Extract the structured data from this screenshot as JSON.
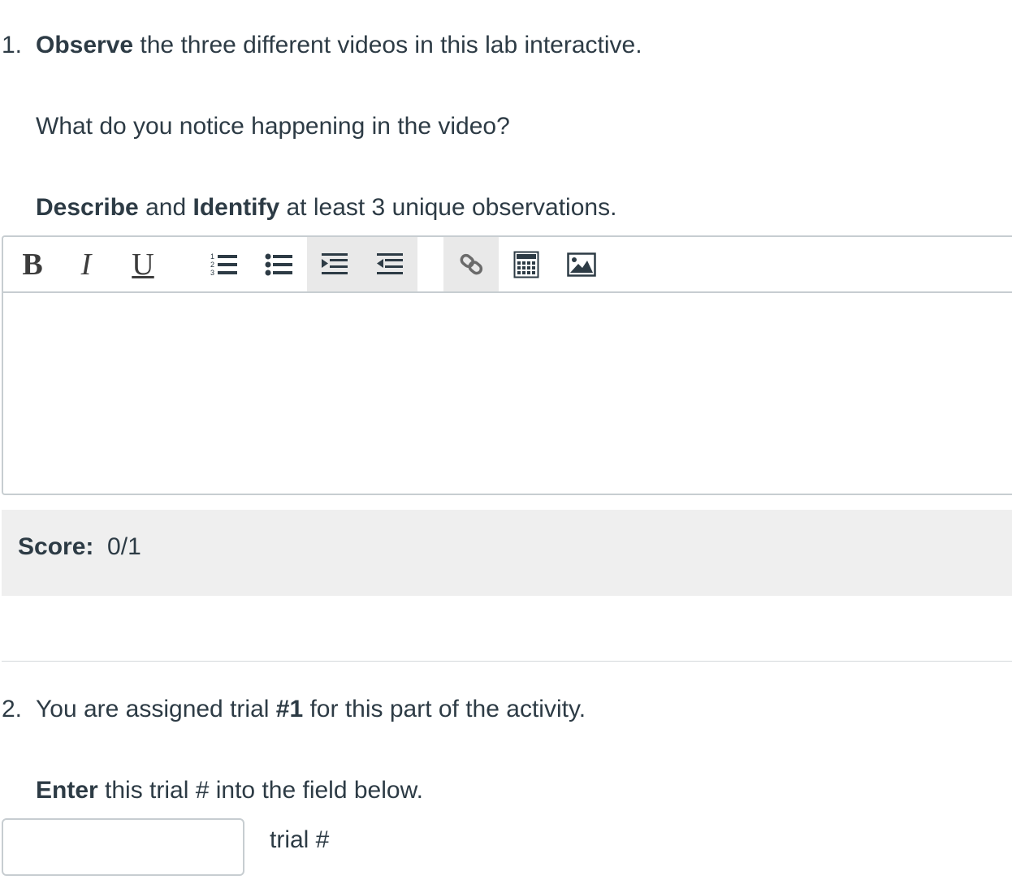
{
  "question1": {
    "number": "1.",
    "bold_lead": "Observe",
    "rest": " the three different videos in this lab interactive.",
    "prompt": "What do you notice happening in the video?",
    "instruction": {
      "bold_a": "Describe",
      "mid_a": " and ",
      "bold_b": "Identify",
      "rest": " at least 3 unique observations."
    }
  },
  "editor": {
    "toolbar": {
      "bold_label": "B",
      "italic_label": "I",
      "underline_label": "U",
      "icons": [
        "ordered-list-icon",
        "bullet-list-icon",
        "indent-icon",
        "outdent-icon",
        "link-icon",
        "calculator-icon",
        "image-icon"
      ]
    },
    "content": ""
  },
  "score": {
    "label": "Score:",
    "value": "0/1"
  },
  "question2": {
    "number": "2.",
    "lead": "You are assigned trial ",
    "bold_trial": "#1",
    "rest": " for this part of the activity.",
    "instruction": {
      "bold_lead": "Enter",
      "rest": " this trial # into the field below."
    },
    "input": {
      "value": "",
      "unit_label": "trial #"
    }
  }
}
